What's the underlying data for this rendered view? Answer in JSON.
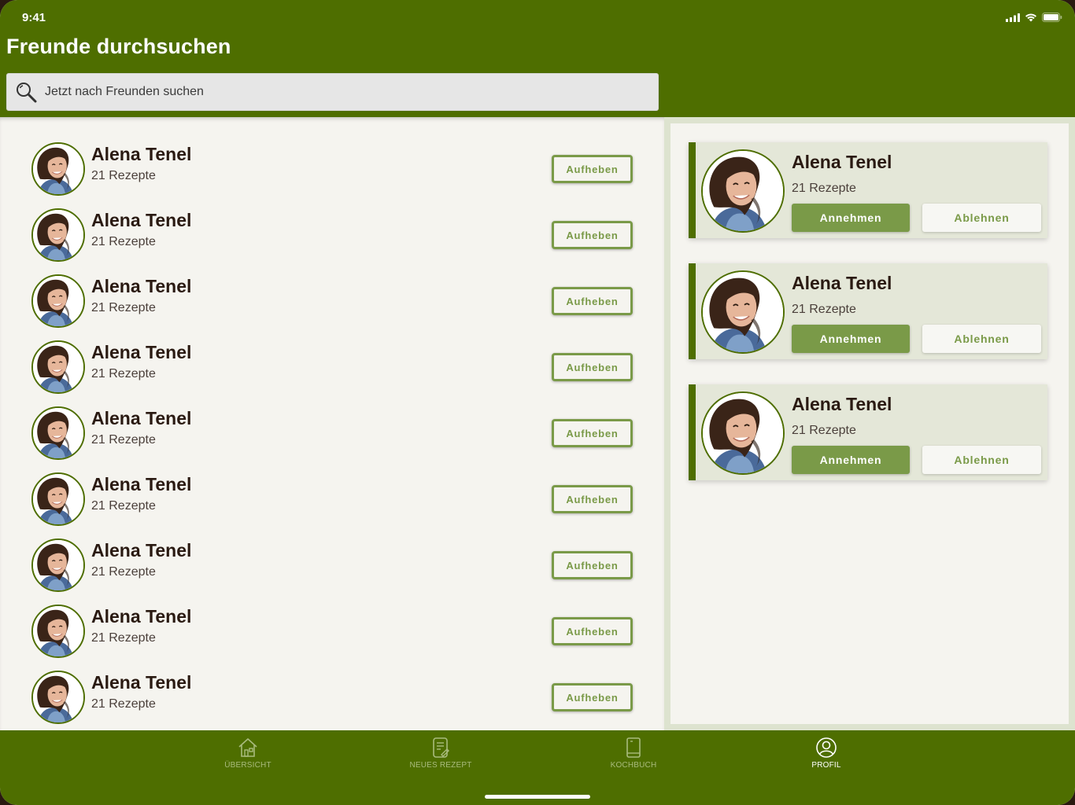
{
  "status_bar": {
    "time": "9:41"
  },
  "header": {
    "title": "Freunde durchsuchen"
  },
  "search": {
    "placeholder": "Jetzt nach Freunden suchen"
  },
  "friends": [
    {
      "name": "Alena Tenel",
      "recipes": "21 Rezepte",
      "action": "Aufheben"
    },
    {
      "name": "Alena Tenel",
      "recipes": "21 Rezepte",
      "action": "Aufheben"
    },
    {
      "name": "Alena Tenel",
      "recipes": "21 Rezepte",
      "action": "Aufheben"
    },
    {
      "name": "Alena Tenel",
      "recipes": "21 Rezepte",
      "action": "Aufheben"
    },
    {
      "name": "Alena Tenel",
      "recipes": "21 Rezepte",
      "action": "Aufheben"
    },
    {
      "name": "Alena Tenel",
      "recipes": "21 Rezepte",
      "action": "Aufheben"
    },
    {
      "name": "Alena Tenel",
      "recipes": "21 Rezepte",
      "action": "Aufheben"
    },
    {
      "name": "Alena Tenel",
      "recipes": "21 Rezepte",
      "action": "Aufheben"
    },
    {
      "name": "Alena Tenel",
      "recipes": "21 Rezepte",
      "action": "Aufheben"
    }
  ],
  "requests": [
    {
      "name": "Alena Tenel",
      "recipes": "21 Rezepte",
      "accept": "Annehmen",
      "decline": "Ablehnen"
    },
    {
      "name": "Alena Tenel",
      "recipes": "21 Rezepte",
      "accept": "Annehmen",
      "decline": "Ablehnen"
    },
    {
      "name": "Alena Tenel",
      "recipes": "21 Rezepte",
      "accept": "Annehmen",
      "decline": "Ablehnen"
    }
  ],
  "tabbar": {
    "tabs": [
      {
        "label": "ÜBERSICHT",
        "icon": "home-icon",
        "active": false
      },
      {
        "label": "NEUES REZEPT",
        "icon": "new-recipe-icon",
        "active": false
      },
      {
        "label": "KOCHBUCH",
        "icon": "cookbook-icon",
        "active": false
      },
      {
        "label": "PROFIL",
        "icon": "profile-icon",
        "active": true
      }
    ]
  },
  "colors": {
    "primary": "#4e6e00",
    "accent": "#7a9a48",
    "background": "#f5f4ef",
    "card": "#e4e7d8",
    "text": "#2a1a12"
  }
}
